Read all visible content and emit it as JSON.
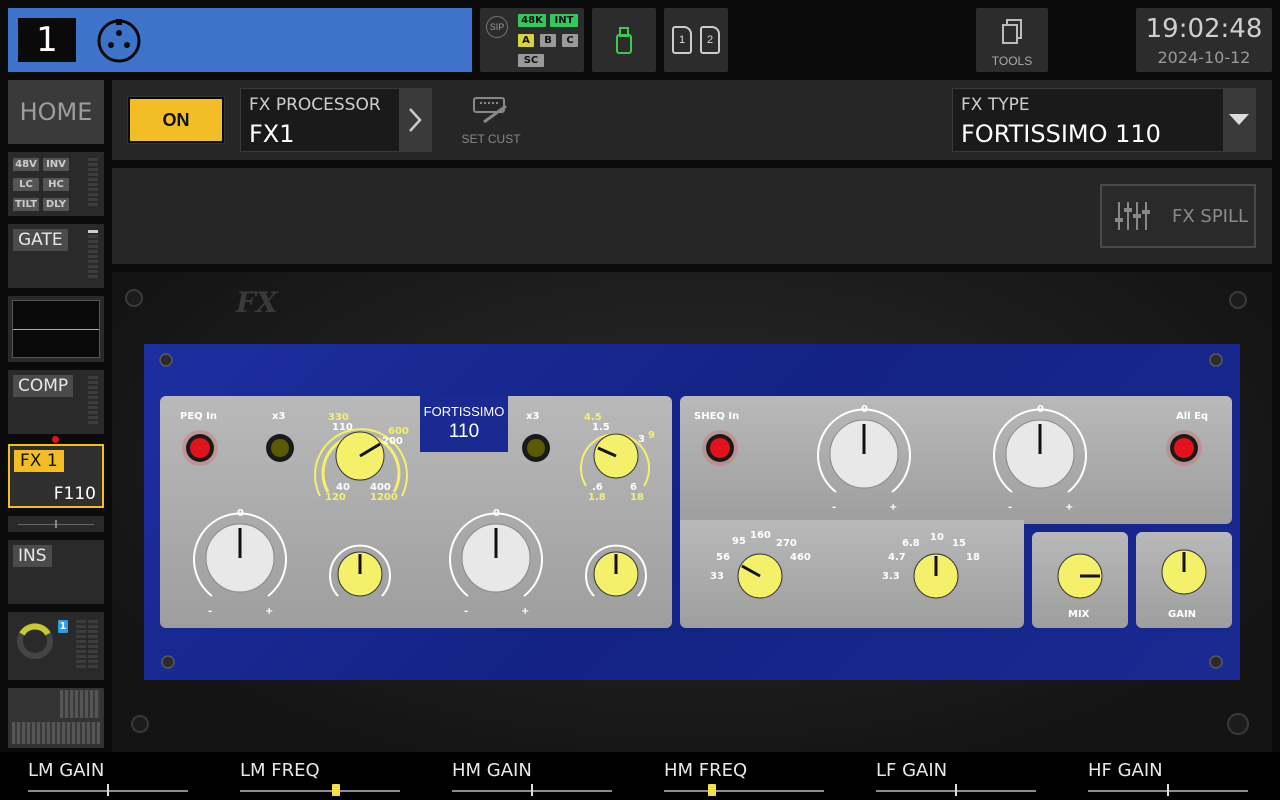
{
  "channel": {
    "number": "1"
  },
  "status": {
    "sip": "SIP",
    "rate": "48K",
    "clock_src": "INT",
    "a": "A",
    "b": "B",
    "c": "C",
    "sc": "SC"
  },
  "cards": [
    "1",
    "2"
  ],
  "tools": {
    "label": "TOOLS"
  },
  "clock": {
    "time": "19:02:48",
    "date": "2024-10-12"
  },
  "sidebar": {
    "home": "HOME",
    "input_flags": [
      "48V",
      "INV",
      "LC",
      "HC",
      "TILT",
      "DLY"
    ],
    "gate": "GATE",
    "comp": "COMP",
    "fx_label": "FX 1",
    "fx_sub": "F110",
    "ins": "INS",
    "bus_num": "1"
  },
  "header": {
    "on_label": "ON",
    "processor_title": "FX PROCESSOR",
    "processor_value": "FX1",
    "set_cust": "SET CUST",
    "type_title": "FX TYPE",
    "type_value": "FORTISSIMO 110",
    "spill_label": "FX SPILL"
  },
  "plugin": {
    "logo": "FX",
    "name_line1": "FORTISSIMO",
    "name_line2": "110",
    "peq_in": "PEQ In",
    "x3_a": "x3",
    "x3_b": "x3",
    "sheq_in": "SHEQ In",
    "all_eq": "All Eq",
    "mix": "MIX",
    "gain": "GAIN",
    "lm_freq_scale": [
      "330",
      "110",
      "600",
      "200",
      "40",
      "400",
      "120",
      "1200"
    ],
    "hm_freq_scale": [
      "4.5",
      "1.5",
      "3",
      "9",
      ".6",
      "6",
      "1.8",
      "18"
    ],
    "lf_scale": [
      "95",
      "160",
      "270",
      "56",
      "460",
      "33"
    ],
    "hf_scale": [
      "6.8",
      "10",
      "15",
      "4.7",
      "18",
      "3.3"
    ],
    "zero": "0",
    "minus": "-",
    "plus": "+"
  },
  "bottom": {
    "params": [
      {
        "label": "LM GAIN",
        "value_fraction": 0.5,
        "type": "mark"
      },
      {
        "label": "LM FREQ",
        "value_fraction": 0.6,
        "type": "thumb"
      },
      {
        "label": "HM GAIN",
        "value_fraction": 0.5,
        "type": "mark"
      },
      {
        "label": "HM FREQ",
        "value_fraction": 0.3,
        "type": "thumb"
      },
      {
        "label": "LF GAIN",
        "value_fraction": 0.5,
        "type": "mark"
      },
      {
        "label": "HF GAIN",
        "value_fraction": 0.5,
        "type": "mark"
      }
    ]
  },
  "colors": {
    "accent": "#f2bd25",
    "channel_blue": "#3d74c9",
    "panel_blue": "#1a2a92",
    "knob_yellow": "#f5f06a",
    "led_red": "#e0121a"
  }
}
